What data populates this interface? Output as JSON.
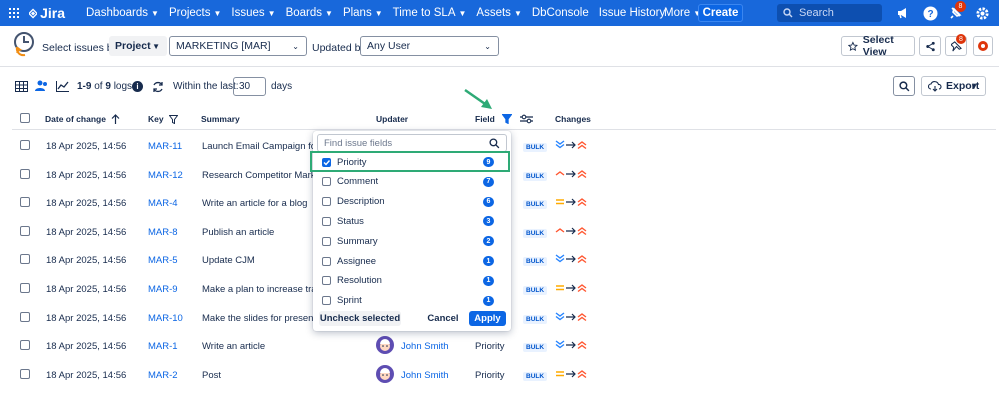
{
  "topnav": {
    "logo": "Jira",
    "items": [
      {
        "label": "Dashboards",
        "chevron": true
      },
      {
        "label": "Projects",
        "chevron": true
      },
      {
        "label": "Issues",
        "chevron": true
      },
      {
        "label": "Boards",
        "chevron": true
      },
      {
        "label": "Plans",
        "chevron": true
      },
      {
        "label": "Time to SLA",
        "chevron": true
      },
      {
        "label": "Assets",
        "chevron": true
      },
      {
        "label": "DbConsole",
        "chevron": false
      },
      {
        "label": "Issue History",
        "chevron": false
      }
    ],
    "more": "More",
    "create": "Create",
    "search_placeholder": "Search",
    "notifications": "8",
    "color": "#1868db"
  },
  "toolbar": {
    "select_issues_label": "Select issues by:",
    "select_issues_value": "Project",
    "project_value": "MARKETING [MAR]",
    "updated_by_label": "Updated by:",
    "updated_by_value": "Any User",
    "select_view": "Select View"
  },
  "logs": {
    "range": "1-9",
    "of": "of",
    "total": "9",
    "unit": "logs",
    "within_label": "Within the last:",
    "days_value": "30",
    "days_label": "days",
    "export": "Export"
  },
  "table": {
    "headers": {
      "date": "Date of change",
      "key": "Key",
      "summary": "Summary",
      "updater": "Updater",
      "field": "Field",
      "changes": "Changes"
    },
    "rows": [
      {
        "date": "18 Apr 2025, 14:56",
        "key": "MAR-11",
        "summary": "Launch Email Campaign for E",
        "updater": "",
        "field": "",
        "from": "lowest",
        "to": "highest"
      },
      {
        "date": "18 Apr 2025, 14:56",
        "key": "MAR-12",
        "summary": "Research Competitor Market",
        "updater": "",
        "field": "",
        "from": "low",
        "to": "highest"
      },
      {
        "date": "18 Apr 2025, 14:56",
        "key": "MAR-4",
        "summary": "Write an article for a blog",
        "updater": "",
        "field": "",
        "from": "medium",
        "to": "highest"
      },
      {
        "date": "18 Apr 2025, 14:56",
        "key": "MAR-8",
        "summary": "Publish an article",
        "updater": "",
        "field": "",
        "from": "low",
        "to": "highest"
      },
      {
        "date": "18 Apr 2025, 14:56",
        "key": "MAR-5",
        "summary": "Update CJM",
        "updater": "",
        "field": "",
        "from": "lowest",
        "to": "highest"
      },
      {
        "date": "18 Apr 2025, 14:56",
        "key": "MAR-9",
        "summary": "Make a plan to increase traff",
        "updater": "",
        "field": "",
        "from": "medium",
        "to": "highest"
      },
      {
        "date": "18 Apr 2025, 14:56",
        "key": "MAR-10",
        "summary": "Make the slides for presenta",
        "updater": "",
        "field": "",
        "from": "lowest",
        "to": "highest"
      },
      {
        "date": "18 Apr 2025, 14:56",
        "key": "MAR-1",
        "summary": "Write an article",
        "updater": "John Smith",
        "field": "Priority",
        "from": "lowest",
        "to": "highest"
      },
      {
        "date": "18 Apr 2025, 14:56",
        "key": "MAR-2",
        "summary": "Post",
        "updater": "John Smith",
        "field": "Priority",
        "from": "medium",
        "to": "highest"
      }
    ],
    "bulk_label": "BULK"
  },
  "field_filter": {
    "search_placeholder": "Find issue fields",
    "options": [
      {
        "label": "Priority",
        "count": "9",
        "checked": true
      },
      {
        "label": "Comment",
        "count": "7",
        "checked": false
      },
      {
        "label": "Description",
        "count": "6",
        "checked": false
      },
      {
        "label": "Status",
        "count": "3",
        "checked": false
      },
      {
        "label": "Summary",
        "count": "2",
        "checked": false
      },
      {
        "label": "Assignee",
        "count": "1",
        "checked": false
      },
      {
        "label": "Resolution",
        "count": "1",
        "checked": false
      },
      {
        "label": "Sprint",
        "count": "1",
        "checked": false
      }
    ],
    "uncheck": "Uncheck selected",
    "cancel": "Cancel",
    "apply": "Apply",
    "highlight_color": "#2eaa76"
  }
}
